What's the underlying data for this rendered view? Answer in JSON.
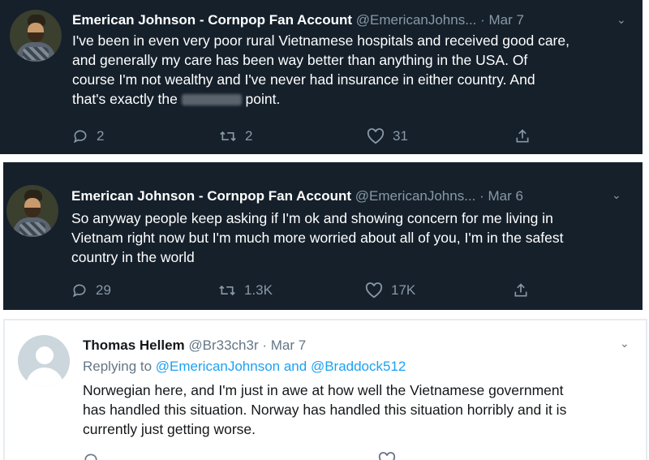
{
  "tweets": [
    {
      "name": "Emerican Johnson - Cornpop Fan Account",
      "handle": "@EmericanJohns...",
      "date": "· Mar 7",
      "text_1": "I've been in even very poor rural Vietnamese hospitals and received good care,",
      "text_2": "and generally my care has been way better than anything in the USA. Of",
      "text_3": "course I'm not wealthy and I've never had insurance in either country. And",
      "text_4a": "that's exactly the ",
      "text_4b": " point.",
      "replies": "2",
      "retweets": "2",
      "likes": "31"
    },
    {
      "name": "Emerican Johnson - Cornpop Fan Account",
      "handle": "@EmericanJohns...",
      "date": "· Mar 6",
      "text_1": "So anyway people keep asking if I'm ok and showing concern for me living in",
      "text_2": "Vietnam right now but I'm much more worried about all of you, I'm in the safest",
      "text_3": "country in the world",
      "replies": "29",
      "retweets": "1.3K",
      "likes": "17K"
    },
    {
      "name": "Thomas Hellem",
      "handle": "@Br33ch3r",
      "date": "· Mar 7",
      "replying_prefix": "Replying to",
      "replying_to": "@EmericanJohnson and @Braddock512",
      "text_1": "Norwegian here, and I'm just in awe at how well the Vietnamese government",
      "text_2": "has handled this situation. Norway has handled this situation horribly and it is",
      "text_3": "currently just getting worse."
    }
  ],
  "icons": {
    "reply": "reply-icon",
    "retweet": "retweet-icon",
    "like": "like-icon",
    "share": "share-icon",
    "menu": "chevron-down-icon"
  },
  "colors": {
    "dark_bg": "#15202b",
    "muted": "#8899a6",
    "link": "#1da1f2"
  }
}
